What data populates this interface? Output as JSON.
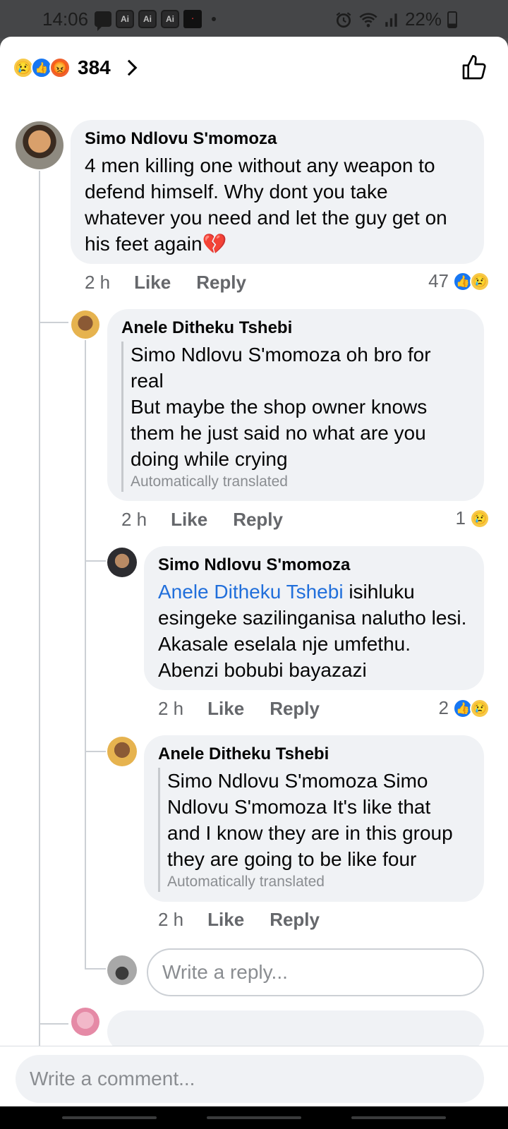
{
  "status_bar": {
    "time": "14:06",
    "ai_badges": [
      "Ai",
      "Ai",
      "Ai"
    ],
    "battery": "22%",
    "icons": [
      "message-icon",
      "alarm-icon",
      "wifi-icon",
      "signal-icon",
      "battery-icon"
    ]
  },
  "reactions_header": {
    "emojis": [
      "sad",
      "like",
      "angry"
    ],
    "count": "384"
  },
  "comments": [
    {
      "author": "Simo Ndlovu S'momoza",
      "text": "4 men killing one without any weapon to defend himself. Why dont you take whatever you need and let the guy get on his feet again💔",
      "time": "2 h",
      "like": "Like",
      "reply": "Reply",
      "reaction_count": "47",
      "reaction_emojis": [
        "like",
        "sad"
      ]
    },
    {
      "author": "Anele Ditheku Tshebi",
      "quoted_text": "Simo Ndlovu S'momoza oh bro for real",
      "text": "But maybe the shop owner knows them he just said no what are you doing while crying",
      "translated": "Automatically translated",
      "time": "2 h",
      "like": "Like",
      "reply": "Reply",
      "reaction_count": "1",
      "reaction_emojis": [
        "sad"
      ]
    },
    {
      "author": "Simo Ndlovu S'momoza",
      "mention": "Anele Ditheku Tshebi",
      "text": " isihluku esingeke sazilinganisa nalutho lesi. Akasale eselala nje umfethu. Abenzi bobubi bayazazi",
      "time": "2 h",
      "like": "Like",
      "reply": "Reply",
      "reaction_count": "2",
      "reaction_emojis": [
        "like",
        "sad"
      ]
    },
    {
      "author": "Anele Ditheku Tshebi",
      "text": "Simo Ndlovu S'momoza Simo Ndlovu S'momoza It's like that and I know they are in this group they are going to be like four",
      "translated": "Automatically translated",
      "time": "2 h",
      "like": "Like",
      "reply": "Reply"
    }
  ],
  "reply_placeholder": "Write a reply...",
  "comment_placeholder": "Write a comment..."
}
